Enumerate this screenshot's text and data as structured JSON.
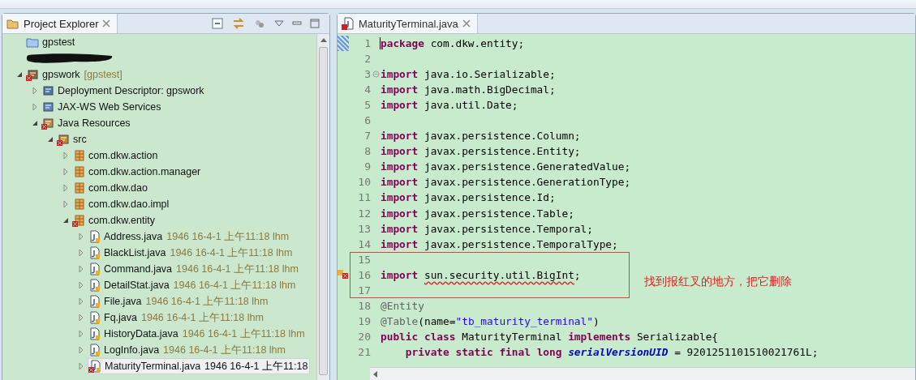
{
  "explorer": {
    "title": "Project Explorer",
    "tree": [
      {
        "kind": "folder",
        "label": "gpstest",
        "error": false,
        "selected": false
      },
      {
        "kind": "redacted"
      },
      {
        "kind": "project",
        "label": "gpswork",
        "decoration": "[gpstest]",
        "error": true,
        "selected": false,
        "expanded": true,
        "children": [
          {
            "kind": "descriptor",
            "label": "Deployment Descriptor: gpswork",
            "error": false,
            "selected": false,
            "expanded": false
          },
          {
            "kind": "webservices",
            "label": "JAX-WS Web Services",
            "error": false,
            "selected": false,
            "expanded": false
          },
          {
            "kind": "resources",
            "label": "Java Resources",
            "error": true,
            "selected": false,
            "expanded": true,
            "children": [
              {
                "kind": "srcfolder",
                "label": "src",
                "error": true,
                "selected": false,
                "expanded": true,
                "children": [
                  {
                    "kind": "package",
                    "label": "com.dkw.action",
                    "error": false,
                    "selected": false,
                    "expanded": false
                  },
                  {
                    "kind": "package",
                    "label": "com.dkw.action.manager",
                    "error": false,
                    "selected": false,
                    "expanded": false
                  },
                  {
                    "kind": "package",
                    "label": "com.dkw.dao",
                    "error": false,
                    "selected": false,
                    "expanded": false
                  },
                  {
                    "kind": "package",
                    "label": "com.dkw.dao.impl",
                    "error": false,
                    "selected": false,
                    "expanded": false
                  },
                  {
                    "kind": "package",
                    "label": "com.dkw.entity",
                    "error": true,
                    "selected": false,
                    "expanded": true,
                    "children": [
                      {
                        "kind": "javafile",
                        "label": "Address.java",
                        "decoration": "1946  16-4-1 上午11:18  lhm",
                        "error": false,
                        "selected": false,
                        "expanded": false
                      },
                      {
                        "kind": "javafile",
                        "label": "BlackList.java",
                        "decoration": "1946  16-4-1 上午11:18  lhm",
                        "error": false,
                        "selected": false,
                        "expanded": false
                      },
                      {
                        "kind": "javafile",
                        "label": "Command.java",
                        "decoration": "1946  16-4-1 上午11:18  lhm",
                        "error": false,
                        "selected": false,
                        "expanded": false
                      },
                      {
                        "kind": "javafile",
                        "label": "DetailStat.java",
                        "decoration": "1946  16-4-1 上午11:18  lhm",
                        "error": false,
                        "selected": false,
                        "expanded": false
                      },
                      {
                        "kind": "javafile",
                        "label": "File.java",
                        "decoration": "1946  16-4-1 上午11:18  lhm",
                        "error": false,
                        "selected": false,
                        "expanded": false
                      },
                      {
                        "kind": "javafile",
                        "label": "Fq.java",
                        "decoration": "1946  16-4-1 上午11:18  lhm",
                        "error": false,
                        "selected": false,
                        "expanded": false
                      },
                      {
                        "kind": "javafile",
                        "label": "HistoryData.java",
                        "decoration": "1946  16-4-1 上午11:18  lhm",
                        "error": false,
                        "selected": false,
                        "expanded": false
                      },
                      {
                        "kind": "javafile",
                        "label": "LogInfo.java",
                        "decoration": "1946  16-4-1 上午11:18  lhm",
                        "error": false,
                        "selected": false,
                        "expanded": false
                      },
                      {
                        "kind": "javafile",
                        "label": "MaturityTerminal.java",
                        "decoration": "1946  16-4-1 上午11:18",
                        "error": true,
                        "selected": true,
                        "expanded": false
                      }
                    ]
                  }
                ]
              }
            ]
          }
        ]
      }
    ]
  },
  "editor": {
    "tab": {
      "label": "MaturityTerminal.java",
      "error": true,
      "selected": true
    },
    "lines": [
      {
        "number": "1",
        "foldable": false,
        "error": false,
        "indented": false,
        "tokens": [
          {
            "kind": "keyword",
            "text": "package"
          },
          {
            "kind": "plain",
            "text": " com.dkw.entity;"
          }
        ]
      },
      {
        "number": "2",
        "foldable": false,
        "error": false
      },
      {
        "number": "3",
        "foldable": true,
        "error": false,
        "indented": false,
        "tokens": [
          {
            "kind": "keyword",
            "text": "import"
          },
          {
            "kind": "plain",
            "text": " java.io.Serializable;"
          }
        ]
      },
      {
        "number": "4",
        "foldable": false,
        "error": false,
        "indented": false,
        "tokens": [
          {
            "kind": "keyword",
            "text": "import"
          },
          {
            "kind": "plain",
            "text": " java.math.BigDecimal;"
          }
        ]
      },
      {
        "number": "5",
        "foldable": false,
        "error": false,
        "indented": false,
        "tokens": [
          {
            "kind": "keyword",
            "text": "import"
          },
          {
            "kind": "plain",
            "text": " java.util.Date;"
          }
        ]
      },
      {
        "number": "6",
        "foldable": false,
        "error": false
      },
      {
        "number": "7",
        "foldable": false,
        "error": false,
        "indented": false,
        "tokens": [
          {
            "kind": "keyword",
            "text": "import"
          },
          {
            "kind": "plain",
            "text": " javax.persistence.Column;"
          }
        ]
      },
      {
        "number": "8",
        "foldable": false,
        "error": false,
        "indented": false,
        "tokens": [
          {
            "kind": "keyword",
            "text": "import"
          },
          {
            "kind": "plain",
            "text": " javax.persistence.Entity;"
          }
        ]
      },
      {
        "number": "9",
        "foldable": false,
        "error": false,
        "indented": false,
        "tokens": [
          {
            "kind": "keyword",
            "text": "import"
          },
          {
            "kind": "plain",
            "text": " javax.persistence.GeneratedValue;"
          }
        ]
      },
      {
        "number": "10",
        "foldable": false,
        "error": false,
        "indented": false,
        "tokens": [
          {
            "kind": "keyword",
            "text": "import"
          },
          {
            "kind": "plain",
            "text": " javax.persistence.GenerationType;"
          }
        ]
      },
      {
        "number": "11",
        "foldable": false,
        "error": false,
        "indented": false,
        "tokens": [
          {
            "kind": "keyword",
            "text": "import"
          },
          {
            "kind": "plain",
            "text": " javax.persistence.Id;"
          }
        ]
      },
      {
        "number": "12",
        "foldable": false,
        "error": false,
        "indented": false,
        "tokens": [
          {
            "kind": "keyword",
            "text": "import"
          },
          {
            "kind": "plain",
            "text": " javax.persistence.Table;"
          }
        ]
      },
      {
        "number": "13",
        "foldable": false,
        "error": false,
        "indented": false,
        "tokens": [
          {
            "kind": "keyword",
            "text": "import"
          },
          {
            "kind": "plain",
            "text": " javax.persistence.Temporal;"
          }
        ]
      },
      {
        "number": "14",
        "foldable": false,
        "error": false,
        "indented": false,
        "tokens": [
          {
            "kind": "keyword",
            "text": "import"
          },
          {
            "kind": "plain",
            "text": " javax.persistence.TemporalType;"
          }
        ]
      },
      {
        "number": "15",
        "foldable": false,
        "error": false
      },
      {
        "number": "16",
        "foldable": false,
        "error": true,
        "indented": false,
        "tokens": [
          {
            "kind": "keyword",
            "text": "import "
          },
          {
            "kind": "error",
            "text": "sun.security.util.BigInt"
          },
          {
            "kind": "plain",
            "text": ";"
          }
        ]
      },
      {
        "number": "17",
        "foldable": false,
        "error": false
      },
      {
        "number": "18",
        "foldable": false,
        "error": false,
        "indented": false,
        "tokens": [
          {
            "kind": "annotation",
            "text": "@Entity"
          }
        ]
      },
      {
        "number": "19",
        "foldable": false,
        "error": false,
        "indented": false,
        "tokens": [
          {
            "kind": "annotation",
            "text": "@Table"
          },
          {
            "kind": "plain",
            "text": "(name="
          },
          {
            "kind": "string",
            "text": "\"tb_maturity_terminal\""
          },
          {
            "kind": "plain",
            "text": ")"
          }
        ]
      },
      {
        "number": "20",
        "foldable": false,
        "error": false,
        "indented": false,
        "tokens": [
          {
            "kind": "keyword",
            "text": "public "
          },
          {
            "kind": "keyword",
            "text": "class "
          },
          {
            "kind": "plain",
            "text": "MaturityTerminal "
          },
          {
            "kind": "keyword",
            "text": "implements "
          },
          {
            "kind": "plain",
            "text": "Serializable{"
          }
        ]
      },
      {
        "number": "21",
        "foldable": false,
        "error": false,
        "indented": true,
        "tokens": [
          {
            "kind": "keyword",
            "text": "private "
          },
          {
            "kind": "keyword",
            "text": "static "
          },
          {
            "kind": "keyword",
            "text": "final "
          },
          {
            "kind": "keyword",
            "text": "long "
          },
          {
            "kind": "field",
            "text": "serialVersionUID"
          },
          {
            "kind": "plain",
            "text": " = 9201251101510021761L;"
          }
        ]
      }
    ],
    "note": {
      "text": "找到报红叉的地方，把它删除"
    }
  }
}
